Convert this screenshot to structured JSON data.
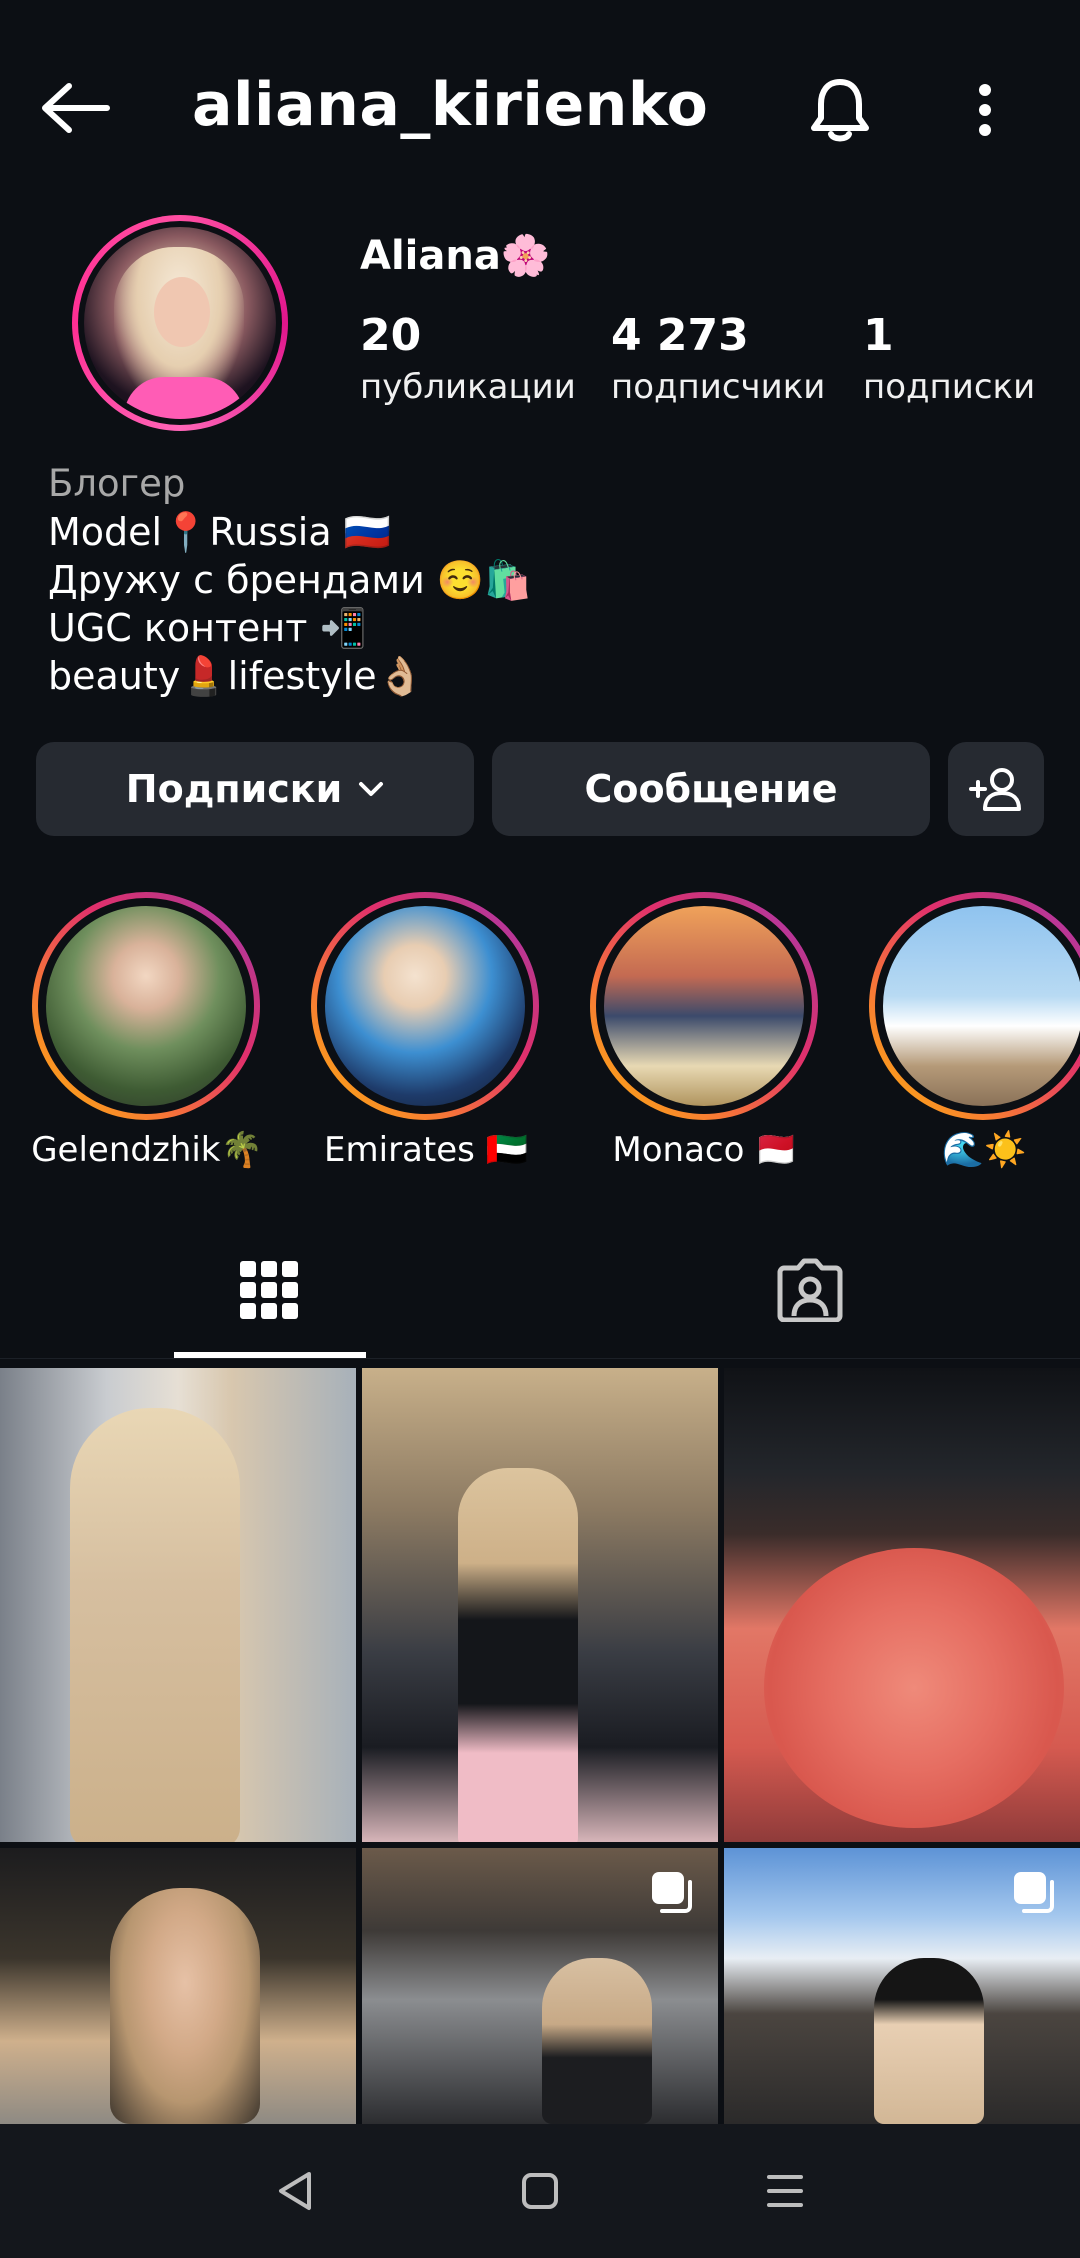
{
  "header": {
    "username": "aliana_kirienko",
    "back_icon": "arrow-left-icon",
    "bell_icon": "bell-icon",
    "more_icon": "more-vertical-icon"
  },
  "profile": {
    "display_name": "Aliana🌸",
    "stats": [
      {
        "value": "20",
        "label": "публикации"
      },
      {
        "value": "4 273",
        "label": "подписчики"
      },
      {
        "value": "1",
        "label": "подписки"
      }
    ],
    "bio": {
      "category": "Блогер",
      "lines": [
        "Model📍Russia 🇷🇺",
        "Дружу с брендами ☺️🛍️",
        "UGC контент 📲",
        "beauty💄lifestyle👌🏼"
      ]
    }
  },
  "actions": {
    "following_label": "Подписки",
    "message_label": "Сообщение",
    "add_user_icon": "add-user-icon"
  },
  "highlights": [
    {
      "label": "Gelendzhik🌴"
    },
    {
      "label": "Emirates 🇦🇪"
    },
    {
      "label": "Monaco 🇲🇨"
    },
    {
      "label": "🌊☀️"
    }
  ],
  "tabs": [
    {
      "name": "grid",
      "icon": "grid-icon",
      "active": true
    },
    {
      "name": "tagged",
      "icon": "tagged-user-icon",
      "active": false
    }
  ],
  "grid": {
    "posts": [
      {
        "multi": false
      },
      {
        "multi": false
      },
      {
        "multi": false
      },
      {
        "multi": false
      },
      {
        "multi": true
      },
      {
        "multi": true
      }
    ]
  },
  "navbar": {
    "back_icon": "nav-back-icon",
    "home_icon": "nav-home-icon",
    "menu_icon": "nav-menu-icon"
  },
  "colors": {
    "background": "#0c0f14",
    "button": "#262a31",
    "avatar_ring": "#ff2e93",
    "highlight_ring_start": "#fdb60a",
    "highlight_ring_end": "#c13584"
  }
}
